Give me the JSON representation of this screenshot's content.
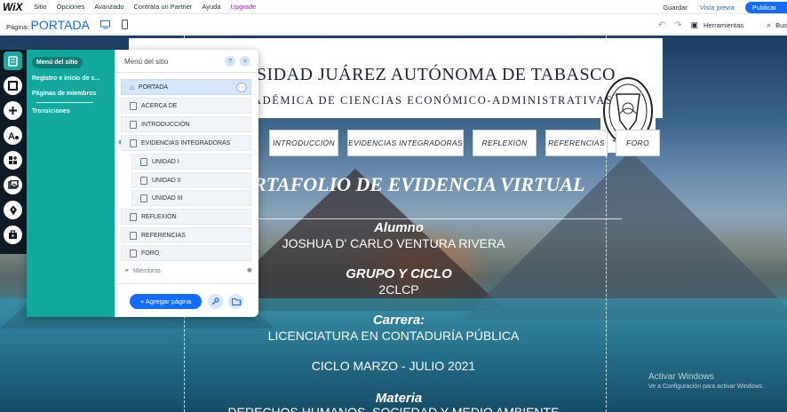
{
  "topbar": {
    "logo": "WiX",
    "menu": [
      "Sitio",
      "Opciones",
      "Avanzado",
      "Contrata un Partner",
      "Ayuda",
      "Upgrade"
    ],
    "save": "Guardar",
    "preview": "Vista previa",
    "publish": "Publicar"
  },
  "secbar": {
    "page_label": "Página:",
    "page_value": "PORTADA",
    "tools": "Herramientas",
    "search": "Bus"
  },
  "site": {
    "university_title": "RSIDAD JUÁREZ AUTÓNOMA DE TABASCO",
    "university_subtitle": "CADÉMICA DE CIENCIAS ECONÓMICO-ADMINISTRATIVAS",
    "nav": [
      "INTRODUCCIÓN",
      "EVIDENCIAS INTEGRADORAS",
      "REFLEXIÓN",
      "REFERENCIAS",
      "FORO"
    ],
    "portfolio_title": "RTAFOLIO DE EVIDENCIA VIRTUAL",
    "alumno_label": "Alumno",
    "alumno_value": "JOSHUA D' CARLO VENTURA RIVERA",
    "grupo_label": "GRUPO Y CICLO",
    "grupo_value": "2CLCP",
    "carrera_label": "Carrera:",
    "carrera_value": "LICENCIATURA EN CONTADURÍA PÚBLICA",
    "ciclo": "CICLO MARZO - JULIO 2021",
    "materia_label": "Materia",
    "materia_value": "DERECHOS HUMANOS, SOCIEDAD Y MEDIO AMBIENTE"
  },
  "watermark": {
    "line1": "Activar Windows",
    "line2": "Ve a Configuración para activar Windows."
  },
  "panel": {
    "side_items": [
      "Menú del sitio",
      "Registro e inicio de s...",
      "Páginas de miembros",
      "Transiciones"
    ],
    "heading": "Menú del sitio",
    "help": "?",
    "close": "×",
    "pages": [
      {
        "label": "PORTADA"
      },
      {
        "label": "ACERCA DE"
      },
      {
        "label": "INTRODUCCIÓN"
      },
      {
        "label": "EVIDENCIAS INTEGRADORAS"
      },
      {
        "label": "UNIDAD I"
      },
      {
        "label": "UNIDAD II"
      },
      {
        "label": "UNIDAD III"
      },
      {
        "label": "REFLEXIÓN"
      },
      {
        "label": "REFERENCIAS"
      },
      {
        "label": "FORO"
      }
    ],
    "members": "Miembros",
    "add_page": "+ Agregar página"
  },
  "icons": {
    "undo": "undo-icon",
    "redo": "redo-icon",
    "tools": "toolbox-icon",
    "search": "search-icon",
    "desktop": "desktop-icon",
    "mobile": "mobile-icon"
  },
  "colors": {
    "brand_blue": "#116dff",
    "panel_teal": "#13a89e",
    "upgrade_purple": "#9a27d5"
  }
}
